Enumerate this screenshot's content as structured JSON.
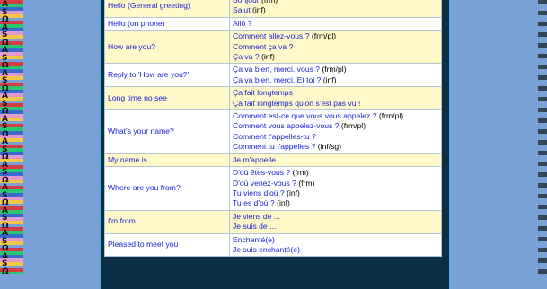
{
  "rows": [
    {
      "en": "Hello (General greeting)",
      "fr": [
        {
          "t": "Bonjour",
          "n": "(frm)"
        },
        {
          "t": "Salut",
          "n": "(inf)"
        }
      ],
      "bg": "yellow"
    },
    {
      "en": "Hello (on phone)",
      "fr": [
        {
          "t": "Allô ?",
          "n": ""
        }
      ],
      "bg": "white"
    },
    {
      "en": "How are you?",
      "fr": [
        {
          "t": "Comment allez-vous ?",
          "n": "(frm/pl)"
        },
        {
          "t": "Comment ça va ?",
          "n": ""
        },
        {
          "t": "Ça va ?",
          "n": "(inf)"
        }
      ],
      "bg": "yellow"
    },
    {
      "en": "Reply to 'How are you?'",
      "fr": [
        {
          "t": "Ça va bien, merci. vous ?",
          "n": "(frm/pl)"
        },
        {
          "t": "Ça va bien, merci. Et toi ?",
          "n": "(inf)"
        }
      ],
      "bg": "white"
    },
    {
      "en": "Long time no see",
      "fr": [
        {
          "t": "Ça fait longtemps !",
          "n": ""
        },
        {
          "t": "Ça fait longtemps qu'on s'est pas vu !",
          "n": ""
        }
      ],
      "bg": "yellow"
    },
    {
      "en": "What's your name?",
      "fr": [
        {
          "t": "Comment est-ce que vous vous appelez ?",
          "n": "(frm/pl)"
        },
        {
          "t": "Comment vous appelez-vous ?",
          "n": "(frm/pl)"
        },
        {
          "t": "Comment t'appelles-tu ?",
          "n": ""
        },
        {
          "t": "Comment tu t'appelles ?",
          "n": "(inf/sg)"
        }
      ],
      "bg": "white"
    },
    {
      "en": "My name is ...",
      "fr": [
        {
          "t": "Je m'appelle ...",
          "n": ""
        }
      ],
      "bg": "yellow"
    },
    {
      "en": "Where are you from?",
      "fr": [
        {
          "t": "D'où êtes-vous ?",
          "n": "(frm)"
        },
        {
          "t": "D'où venez-vous ?",
          "n": "(frm)"
        },
        {
          "t": "Tu viens d'où ?",
          "n": "(inf)"
        },
        {
          "t": "Tu es d'où ?",
          "n": "(inf)"
        }
      ],
      "bg": "white"
    },
    {
      "en": "I'm from ...",
      "fr": [
        {
          "t": "Je viens de ...",
          "n": ""
        },
        {
          "t": "Je suis de ...",
          "n": ""
        }
      ],
      "bg": "yellow"
    },
    {
      "en": "Pleased to meet you",
      "fr": [
        {
          "t": "Enchanté(e)",
          "n": ""
        },
        {
          "t": "Je suis enchanté(e)",
          "n": ""
        }
      ],
      "bg": "white"
    }
  ],
  "side_letters": [
    "A",
    "S",
    "Ω",
    "A",
    "S",
    "Ω",
    "A",
    "S",
    "Ω",
    "A",
    "S",
    "Ω",
    "A",
    "S",
    "Ω",
    "A",
    "S",
    "Ω",
    "A",
    "S",
    "Ω",
    "A",
    "S",
    "Ω",
    "A",
    "S",
    "Ω",
    "A",
    "S",
    "Ω",
    "A",
    "S",
    "Ω",
    "A",
    "S",
    "Ω"
  ]
}
